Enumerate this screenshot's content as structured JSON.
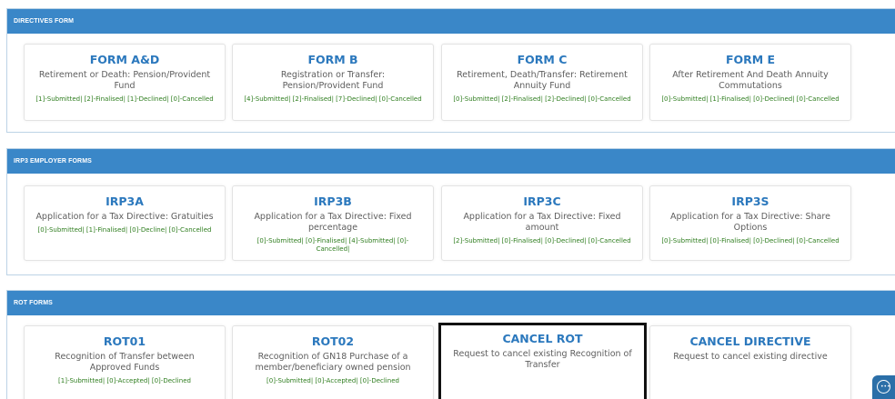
{
  "sections": [
    {
      "header": "DIRECTIVES FORM",
      "cards": [
        {
          "title": "FORM A&D",
          "desc": "Retirement or Death: Pension/Provident Fund",
          "status": "[1]-Submitted| [2]-Finalised| [1]-Declined| [0]-Cancelled"
        },
        {
          "title": "FORM B",
          "desc": "Registration or Transfer: Pension/Provident Fund",
          "status": "[4]-Submitted| [2]-Finalised| [7]-Declined| [0]-Cancelled"
        },
        {
          "title": "FORM C",
          "desc": "Retirement, Death/Transfer: Retirement Annuity Fund",
          "status": "[0]-Submitted| [2]-Finalised| [2]-Declined| [0]-Cancelled"
        },
        {
          "title": "FORM E",
          "desc": "After Retirement And Death Annuity Commutations",
          "status": "[0]-Submitted| [1]-Finalised| [0]-Declined| [0]-Cancelled"
        }
      ]
    },
    {
      "header": "IRP3 EMPLOYER FORMS",
      "cards": [
        {
          "title": "IRP3A",
          "desc": "Application for a Tax Directive: Gratuities",
          "status": "[0]-Submitted| [1]-Finalised| [0]-Decline| [0]-Cancelled"
        },
        {
          "title": "IRP3B",
          "desc": "Application for a Tax Directive: Fixed percentage",
          "status": "[0]-Submitted| [0]-Finalised| [4]-Submitted| [0]-Cancelled|"
        },
        {
          "title": "IRP3C",
          "desc": "Application for a Tax Directive: Fixed amount",
          "status": "[2]-Submitted| [0]-Finalised| [0]-Declined| [0]-Cancelled"
        },
        {
          "title": "IRP3S",
          "desc": "Application for a Tax Directive: Share Options",
          "status": "[0]-Submitted| [0]-Finalised| [0]-Declined| [0]-Cancelled"
        }
      ]
    },
    {
      "header": "ROT FORMS",
      "cards": [
        {
          "title": "ROT01",
          "desc": "Recognition of Transfer between Approved Funds",
          "status": "[1]-Submitted| [0]-Accepted| [0]-Declined"
        },
        {
          "title": "ROT02",
          "desc": "Recognition of GN18 Purchase of a member/beneficiary owned pension",
          "status": "[0]-Submitted| [0]-Accepted| [0]-Declined"
        },
        {
          "title": "CANCEL ROT",
          "desc": "Request to cancel existing Recognition of Transfer",
          "status": ""
        },
        {
          "title": "CANCEL DIRECTIVE",
          "desc": "Request to cancel existing directive",
          "status": ""
        }
      ]
    }
  ],
  "chat": {
    "icon": "chat-bubble-icon"
  }
}
